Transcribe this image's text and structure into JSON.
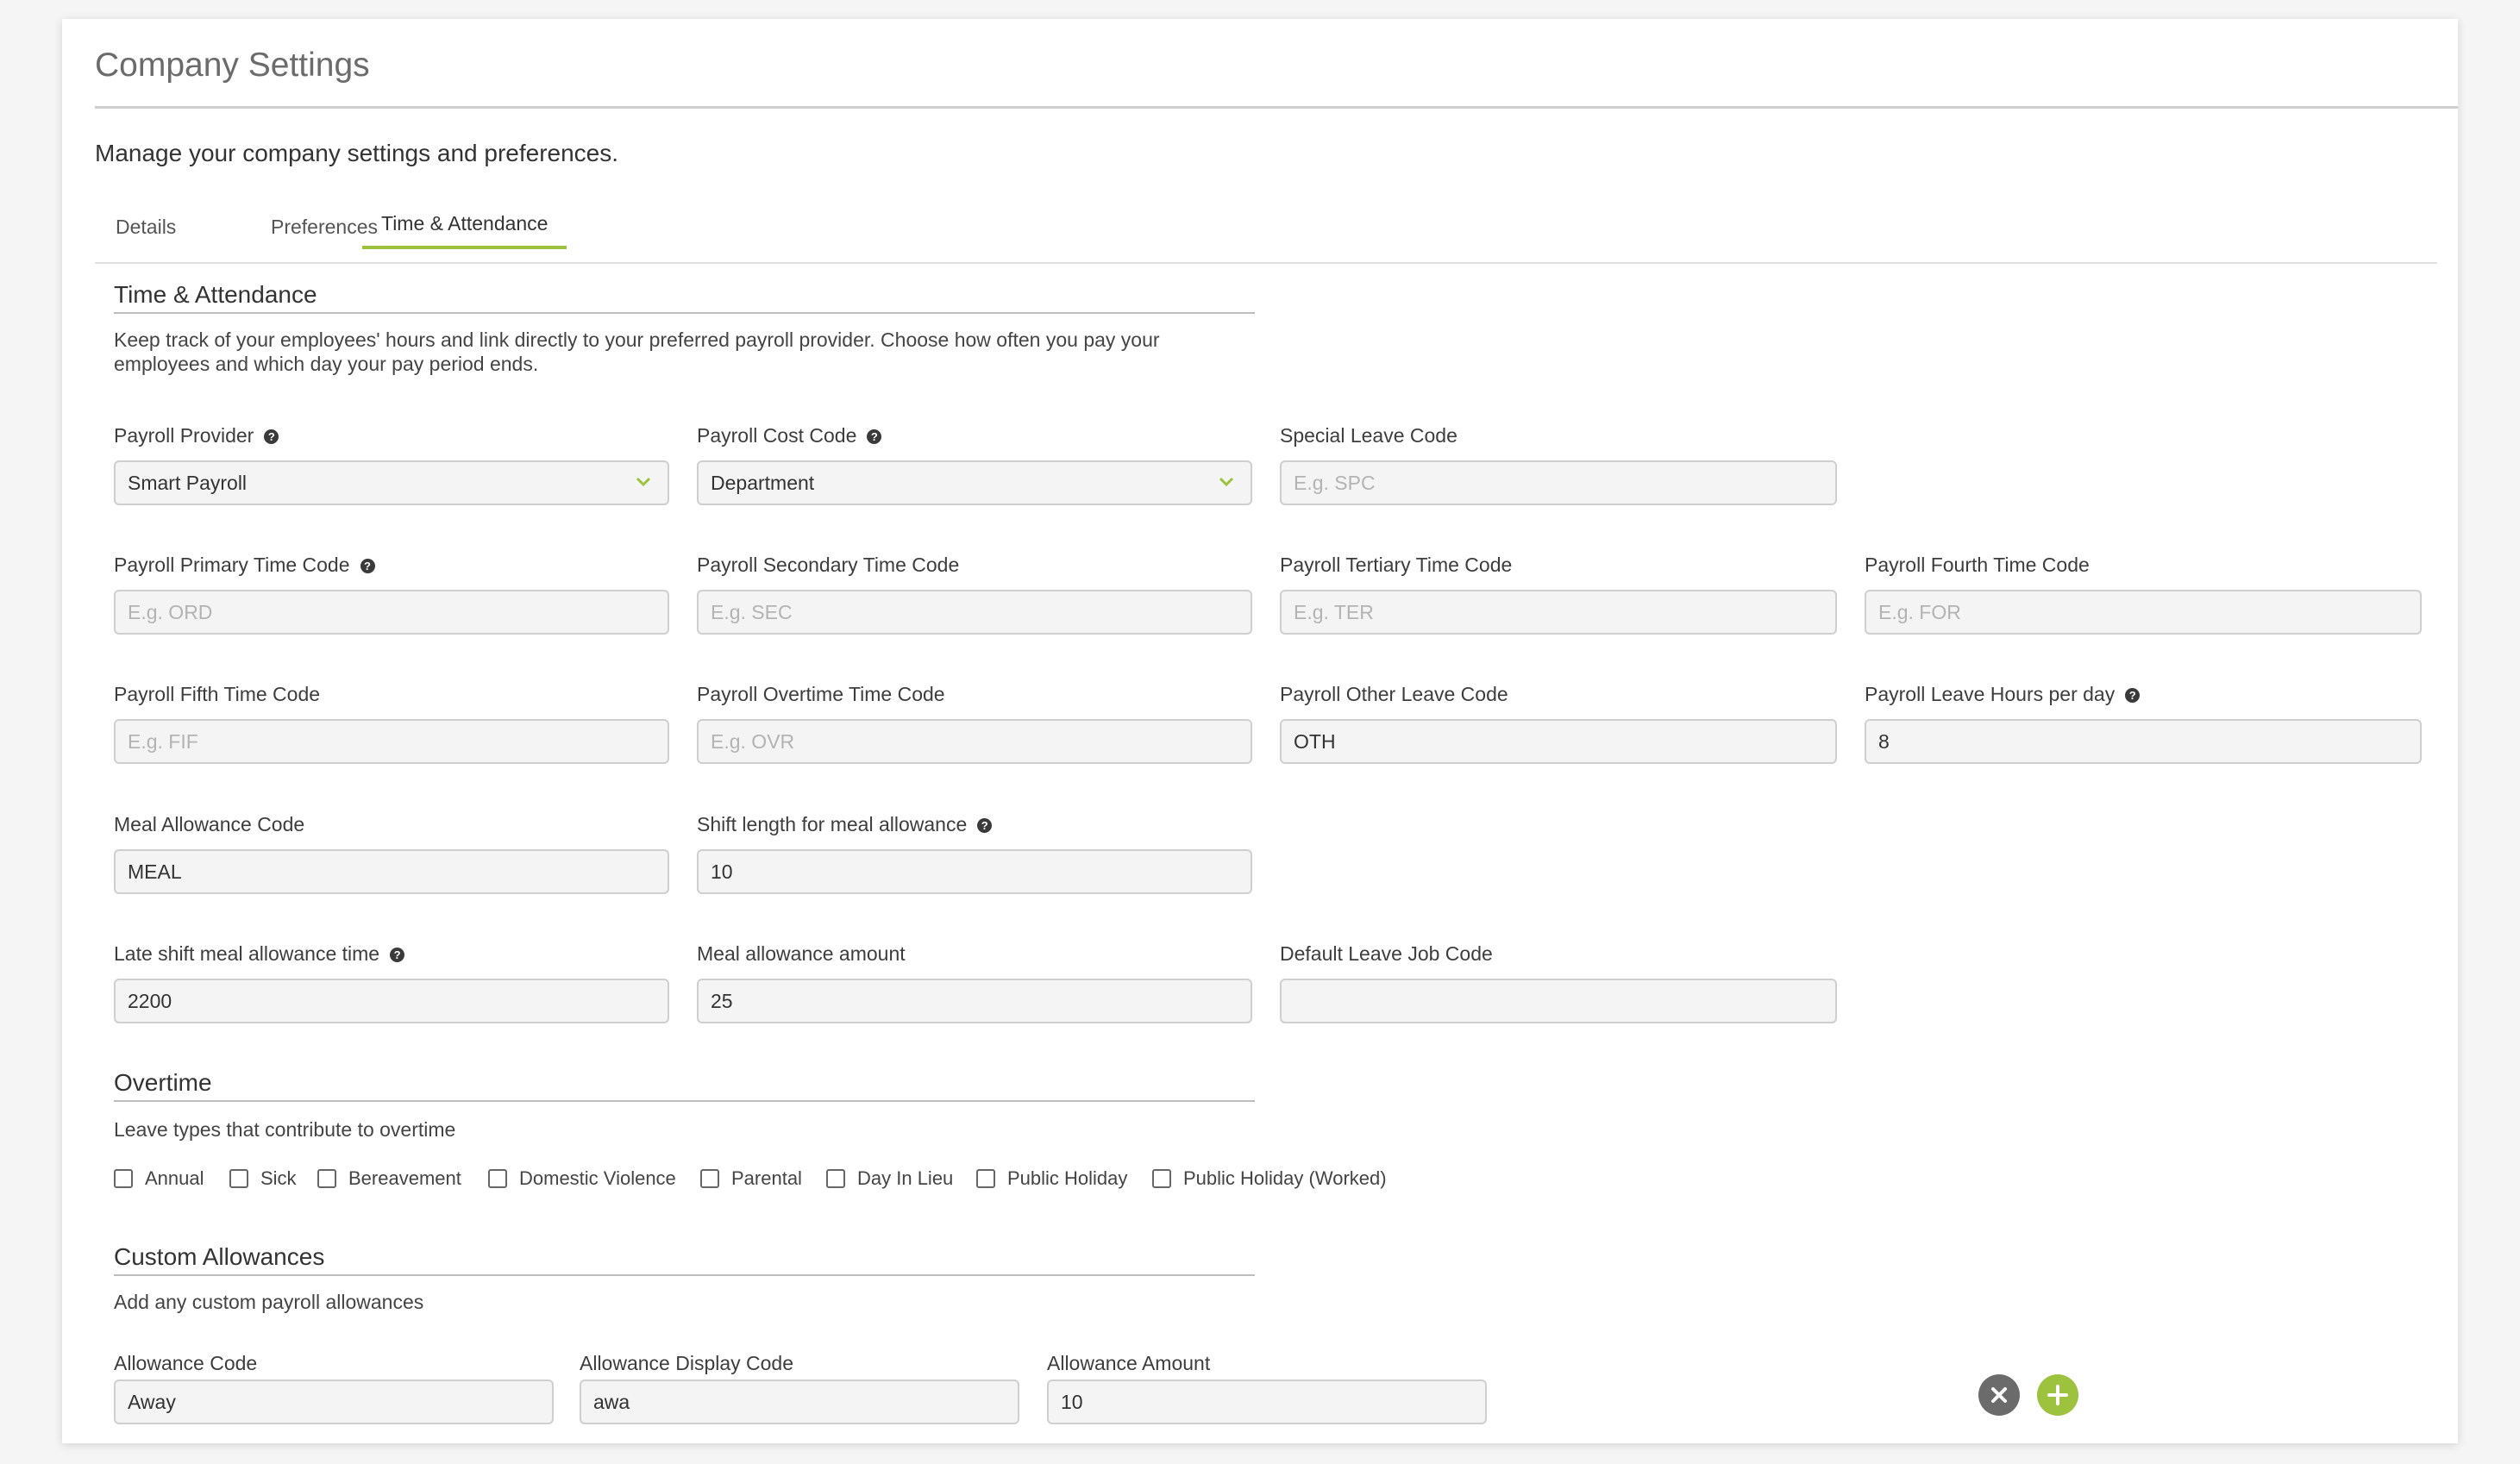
{
  "page": {
    "title": "Company Settings",
    "subtitle": "Manage your company settings and preferences."
  },
  "tabs": {
    "details": "Details",
    "preferences": "Preferences",
    "time_attendance": "Time & Attendance",
    "active": "Time & Attendance"
  },
  "section": {
    "title": "Time & Attendance",
    "description_line1": "Keep track of your employees' hours and link directly to your preferred payroll provider. Choose how often you pay your",
    "description_line2": "employees and which day your pay period ends."
  },
  "fields": {
    "payroll_provider": {
      "label": "Payroll Provider",
      "value": "Smart Payroll"
    },
    "payroll_cost_code": {
      "label": "Payroll Cost Code",
      "value": "Department"
    },
    "special_leave_code": {
      "label": "Special Leave Code",
      "value": "",
      "placeholder": "E.g. SPC"
    },
    "primary_time_code": {
      "label": "Payroll Primary Time Code",
      "value": "",
      "placeholder": "E.g. ORD"
    },
    "secondary_time_code": {
      "label": "Payroll Secondary Time Code",
      "value": "",
      "placeholder": "E.g. SEC"
    },
    "tertiary_time_code": {
      "label": "Payroll Tertiary Time Code",
      "value": "",
      "placeholder": "E.g. TER"
    },
    "fourth_time_code": {
      "label": "Payroll Fourth Time Code",
      "value": "",
      "placeholder": "E.g. FOR"
    },
    "fifth_time_code": {
      "label": "Payroll Fifth Time Code",
      "value": "",
      "placeholder": "E.g. FIF"
    },
    "overtime_time_code": {
      "label": "Payroll Overtime Time Code",
      "value": "",
      "placeholder": "E.g. OVR"
    },
    "other_leave_code": {
      "label": "Payroll Other Leave Code",
      "value": "OTH"
    },
    "leave_hours_per_day": {
      "label": "Payroll Leave Hours per day",
      "value": "8"
    },
    "meal_allowance_code": {
      "label": "Meal Allowance Code",
      "value": "MEAL"
    },
    "shift_length_meal": {
      "label": "Shift length for meal allowance",
      "value": "10"
    },
    "late_shift_meal_time": {
      "label": "Late shift meal allowance time",
      "value": "2200"
    },
    "meal_allowance_amount": {
      "label": "Meal allowance amount",
      "value": "25"
    },
    "default_leave_job_code": {
      "label": "Default Leave Job Code",
      "value": ""
    }
  },
  "overtime": {
    "title": "Overtime",
    "description": "Leave types that contribute to overtime",
    "options": [
      {
        "label": "Annual",
        "checked": false
      },
      {
        "label": "Sick",
        "checked": false
      },
      {
        "label": "Bereavement",
        "checked": false
      },
      {
        "label": "Domestic Violence",
        "checked": false
      },
      {
        "label": "Parental",
        "checked": false
      },
      {
        "label": "Day In Lieu",
        "checked": false
      },
      {
        "label": "Public Holiday",
        "checked": false
      },
      {
        "label": "Public Holiday (Worked)",
        "checked": false
      }
    ]
  },
  "custom_allowances": {
    "title": "Custom Allowances",
    "description": "Add any custom payroll allowances",
    "code_label": "Allowance Code",
    "display_code_label": "Allowance Display Code",
    "amount_label": "Allowance Amount",
    "rows": [
      {
        "code": "Away",
        "display_code": "awa",
        "amount": "10"
      }
    ]
  },
  "icons": {
    "help": "question-circle-icon",
    "remove": "close-circle-icon",
    "add": "plus-circle-icon",
    "dropdown": "chevron-down-icon"
  },
  "colors": {
    "accent": "#9cc23e",
    "remove_button": "#6b6b6b",
    "help_icon": "#3a3a3a"
  }
}
